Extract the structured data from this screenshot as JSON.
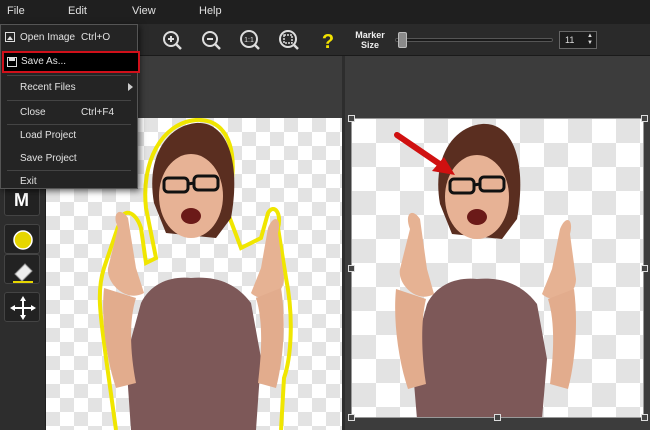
{
  "menubar": {
    "items": [
      "File",
      "Edit",
      "View",
      "Help"
    ]
  },
  "file_menu": {
    "items": [
      {
        "label": "Open Image",
        "shortcut": "Ctrl+O"
      },
      {
        "label": "Save As...",
        "shortcut": ""
      },
      {
        "label": "Recent Files",
        "shortcut": ""
      },
      {
        "label": "Close",
        "shortcut": "Ctrl+F4"
      },
      {
        "label": "Load Project",
        "shortcut": ""
      },
      {
        "label": "Save Project",
        "shortcut": ""
      },
      {
        "label": "Exit",
        "shortcut": ""
      }
    ]
  },
  "toolbar": {
    "marker_label_1": "Marker",
    "marker_label_2": "Size",
    "marker_size_value": "11",
    "marker_size_fraction": 0.02,
    "zoom_fit_label": "1:1",
    "help_glyph": "?"
  },
  "tools": {
    "manual_label": "M",
    "marker_color": "#e6d600"
  },
  "colors": {
    "highlight_border": "#d0101a",
    "outline": "#f0e600",
    "arrow": "#d01010"
  }
}
